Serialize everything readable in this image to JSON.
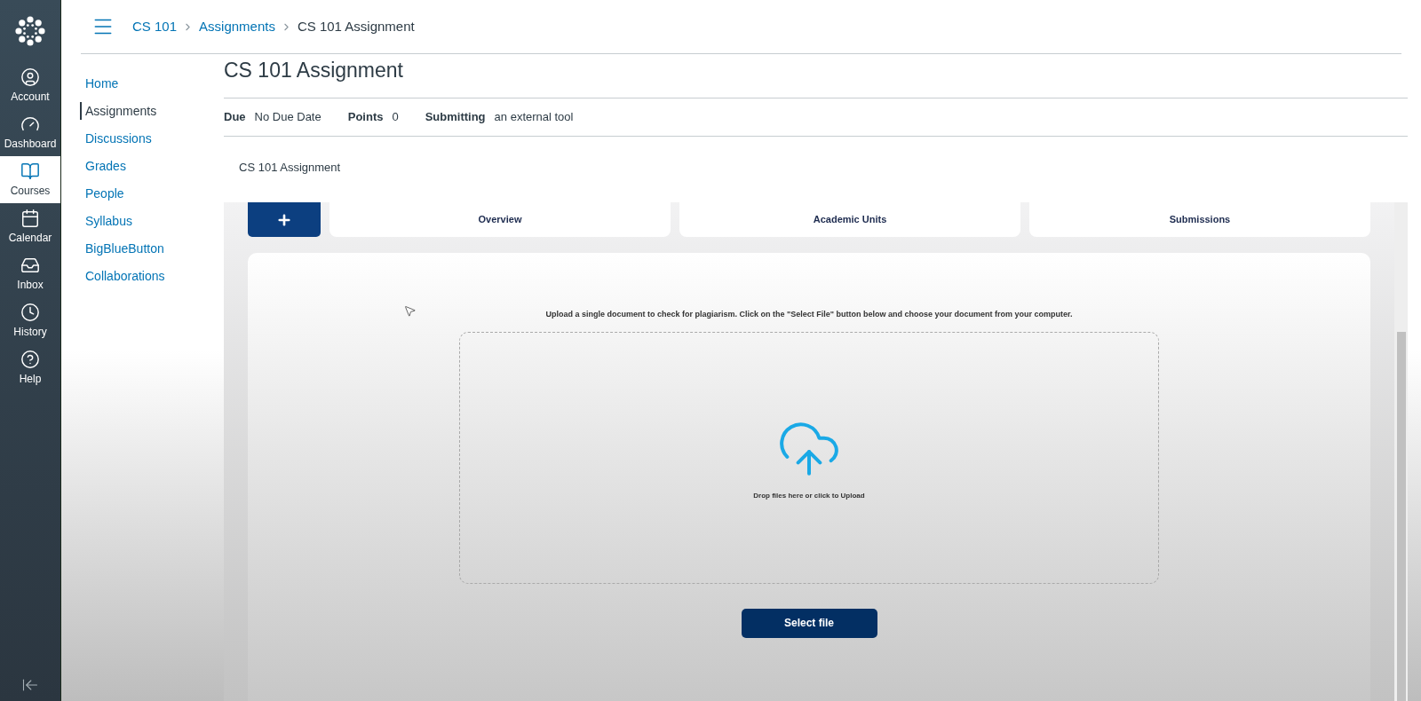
{
  "global_nav": {
    "items": [
      {
        "label": "Account",
        "selected": false
      },
      {
        "label": "Dashboard",
        "selected": false
      },
      {
        "label": "Courses",
        "selected": true
      },
      {
        "label": "Calendar",
        "selected": false
      },
      {
        "label": "Inbox",
        "selected": false
      },
      {
        "label": "History",
        "selected": false
      },
      {
        "label": "Help",
        "selected": false
      }
    ]
  },
  "breadcrumbs": [
    "CS 101",
    "Assignments",
    "CS 101 Assignment"
  ],
  "course_nav": {
    "items": [
      {
        "label": "Home",
        "selected": false
      },
      {
        "label": "Assignments",
        "selected": true
      },
      {
        "label": "Discussions",
        "selected": false
      },
      {
        "label": "Grades",
        "selected": false
      },
      {
        "label": "People",
        "selected": false
      },
      {
        "label": "Syllabus",
        "selected": false
      },
      {
        "label": "BigBlueButton",
        "selected": false
      },
      {
        "label": "Collaborations",
        "selected": false
      }
    ]
  },
  "assignment": {
    "title": "CS 101 Assignment",
    "details": [
      {
        "label": "Due",
        "value": "No Due Date"
      },
      {
        "label": "Points",
        "value": "0"
      },
      {
        "label": "Submitting",
        "value": "an external tool"
      }
    ],
    "description": "CS 101 Assignment"
  },
  "tool": {
    "tabs": [
      {
        "label": "Overview",
        "selected": false
      },
      {
        "label": "Academic Units",
        "selected": false
      },
      {
        "label": "Submissions",
        "selected": false
      }
    ],
    "instruction": "Upload a single document to check for plagiarism. Click on the \"Select File\" button below and choose your document from your computer.",
    "dropzone_text": "Drop files here or click to Upload",
    "button": "Select file"
  }
}
